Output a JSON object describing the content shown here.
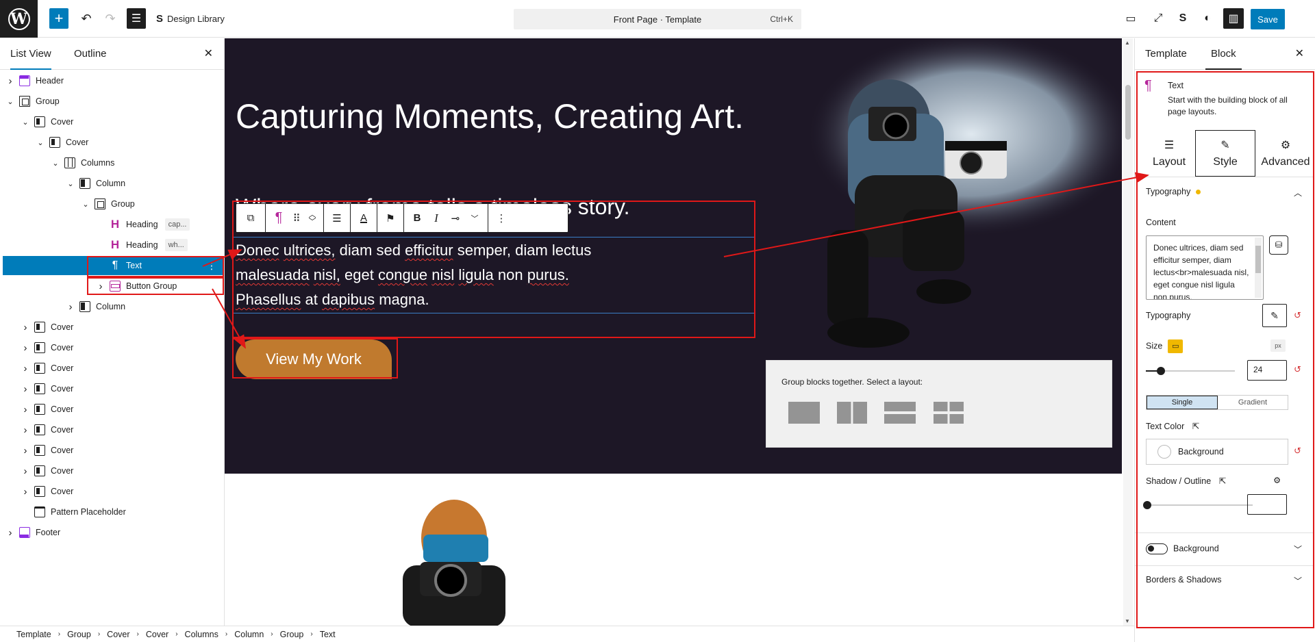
{
  "topbar": {
    "library_label": "Design Library",
    "command_label": "Front Page · Template",
    "command_shortcut": "Ctrl+K",
    "save_label": "Save"
  },
  "left_panel": {
    "tabs": [
      "List View",
      "Outline"
    ],
    "tree": [
      {
        "label": "Header",
        "icon": "header",
        "depth": 0,
        "expandable": true,
        "expanded": false
      },
      {
        "label": "Group",
        "icon": "group",
        "depth": 0,
        "expandable": true,
        "expanded": true
      },
      {
        "label": "Cover",
        "icon": "cover",
        "depth": 1,
        "expandable": true,
        "expanded": true
      },
      {
        "label": "Cover",
        "icon": "cover",
        "depth": 2,
        "expandable": true,
        "expanded": true
      },
      {
        "label": "Columns",
        "icon": "columns",
        "depth": 3,
        "expandable": true,
        "expanded": true
      },
      {
        "label": "Column",
        "icon": "column",
        "depth": 4,
        "expandable": true,
        "expanded": true
      },
      {
        "label": "Group",
        "icon": "group",
        "depth": 5,
        "expandable": true,
        "expanded": true
      },
      {
        "label": "Heading",
        "icon": "heading",
        "depth": 6,
        "chip": "cap...",
        "expandable": false
      },
      {
        "label": "Heading",
        "icon": "heading",
        "depth": 6,
        "chip": "wh...",
        "expandable": false
      },
      {
        "label": "Text",
        "icon": "text",
        "depth": 6,
        "selected": true,
        "expandable": false
      },
      {
        "label": "Button Group",
        "icon": "button",
        "depth": 6,
        "expandable": true,
        "expanded": false
      },
      {
        "label": "Column",
        "icon": "column",
        "depth": 4,
        "expandable": true,
        "expanded": false
      },
      {
        "label": "Cover",
        "icon": "cover",
        "depth": 1,
        "expandable": true,
        "expanded": false
      },
      {
        "label": "Cover",
        "icon": "cover",
        "depth": 1,
        "expandable": true,
        "expanded": false
      },
      {
        "label": "Cover",
        "icon": "cover",
        "depth": 1,
        "expandable": true,
        "expanded": false
      },
      {
        "label": "Cover",
        "icon": "cover",
        "depth": 1,
        "expandable": true,
        "expanded": false
      },
      {
        "label": "Cover",
        "icon": "cover",
        "depth": 1,
        "expandable": true,
        "expanded": false
      },
      {
        "label": "Cover",
        "icon": "cover",
        "depth": 1,
        "expandable": true,
        "expanded": false
      },
      {
        "label": "Cover",
        "icon": "cover",
        "depth": 1,
        "expandable": true,
        "expanded": false
      },
      {
        "label": "Cover",
        "icon": "cover",
        "depth": 1,
        "expandable": true,
        "expanded": false
      },
      {
        "label": "Cover",
        "icon": "cover",
        "depth": 1,
        "expandable": true,
        "expanded": false
      },
      {
        "label": "Pattern Placeholder",
        "icon": "pattern",
        "depth": 1,
        "expandable": false
      },
      {
        "label": "Footer",
        "icon": "footer",
        "depth": 0,
        "expandable": true,
        "expanded": false
      }
    ]
  },
  "canvas": {
    "title": "Capturing Moments, Creating Art.",
    "subtitle": "Where every frame tells a timeless story.",
    "paragraph": [
      "Donec ultrices, diam sed efficitur semper, diam lectus",
      "malesuada nisl, eget congue nisl ligula non purus.",
      "Phasellus at dapibus magna."
    ],
    "button_label": "View My Work",
    "group_layout_label": "Group blocks together. Select a layout:"
  },
  "breadcrumb": [
    "Template",
    "Group",
    "Cover",
    "Cover",
    "Columns",
    "Column",
    "Group",
    "Text"
  ],
  "right_panel": {
    "tabs": [
      "Template",
      "Block"
    ],
    "block_name": "Text",
    "block_description": "Start with the building block of all page layouts.",
    "subtabs": [
      "Layout",
      "Style",
      "Advanced"
    ],
    "typography_heading": "Typography",
    "content_label": "Content",
    "content_value": "Donec ultrices, diam sed efficitur semper, diam lectus<br>malesuada nisl, eget congue nisl ligula non purus.",
    "typography_label": "Typography",
    "size_label": "Size",
    "size_unit": "px",
    "size_value": "24",
    "color_modes": [
      "Single",
      "Gradient"
    ],
    "text_color_label": "Text Color",
    "background_label": "Background",
    "shadow_label": "Shadow / Outline",
    "background_toggle_label": "Background",
    "borders_label": "Borders & Shadows"
  },
  "colors": {
    "accent": "#007cba",
    "hero_bg": "#1d1726",
    "button": "#c07a2e",
    "annotation": "#e01818",
    "indicator": "#f0b800"
  }
}
